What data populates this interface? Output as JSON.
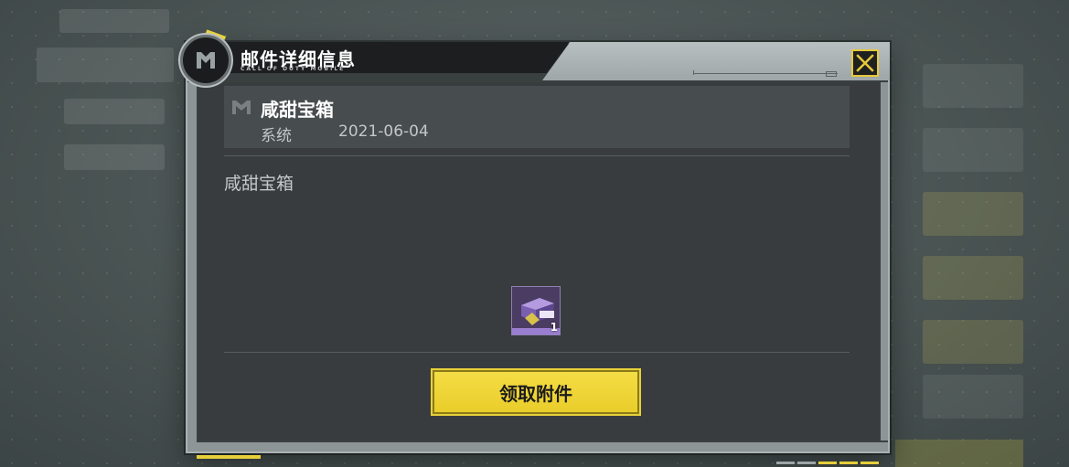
{
  "dialog": {
    "title": "邮件详细信息",
    "subtitle": "CALL OF DUTY MOBILE",
    "close_icon": "close-x-icon",
    "accent_color": "#e9cd2a"
  },
  "mail": {
    "title": "咸甜宝箱",
    "sender": "系统",
    "date": "2021-06-04",
    "body": "咸甜宝箱",
    "icon": "mail-m-icon"
  },
  "attachments": [
    {
      "icon": "treasure-chest-icon",
      "count": "1",
      "rarity_color": "#9a7ed0"
    }
  ],
  "actions": {
    "claim_label": "领取附件"
  }
}
